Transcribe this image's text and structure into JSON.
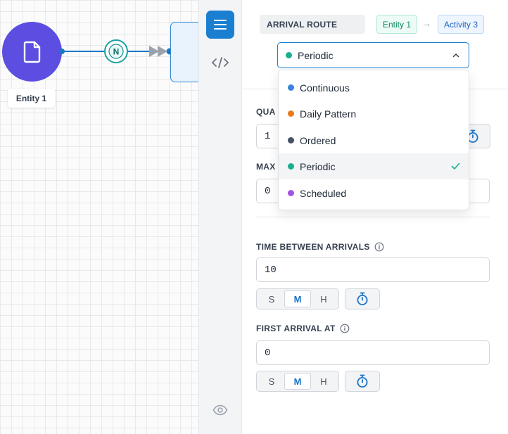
{
  "canvas": {
    "entity_label": "Entity 1",
    "edge_badge": "N"
  },
  "toolbar": {
    "items": [
      "menu-icon",
      "code-icon",
      "eye-icon"
    ]
  },
  "panel": {
    "route_label": "ARRIVAL ROUTE",
    "route_from": "Entity 1",
    "route_arrow": "→",
    "route_to": "Activity 3",
    "select_value": "Periodic",
    "select_color": "#1aae8f",
    "quantity": {
      "label": "QUA",
      "value": "1"
    },
    "max": {
      "label": "MAX",
      "value": "0"
    },
    "time_between": {
      "label": "TIME BETWEEN ARRIVALS",
      "value": "10",
      "units": [
        "S",
        "M",
        "H"
      ],
      "selected_unit": "M"
    },
    "first_arrival": {
      "label": "FIRST ARRIVAL AT",
      "value": "0",
      "units": [
        "S",
        "M",
        "H"
      ],
      "selected_unit": "M"
    }
  },
  "dropdown": {
    "options": [
      {
        "label": "Continuous",
        "color": "#3b82e0"
      },
      {
        "label": "Daily Pattern",
        "color": "#e97a1c"
      },
      {
        "label": "Ordered",
        "color": "#445163"
      },
      {
        "label": "Periodic",
        "color": "#1aae8f"
      },
      {
        "label": "Scheduled",
        "color": "#a552e0"
      }
    ],
    "selected": "Periodic"
  },
  "colors": {
    "accent": "#1a7fd1",
    "entity_node": "#5b4ee0"
  }
}
